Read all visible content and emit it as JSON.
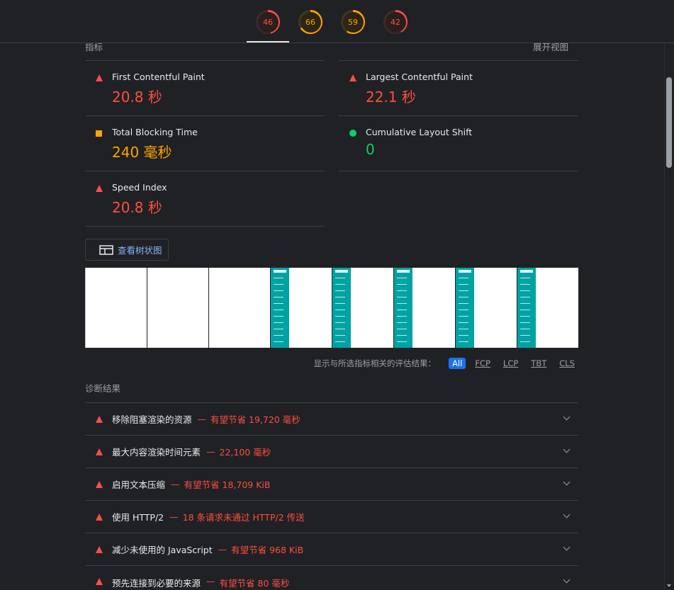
{
  "scores": [
    {
      "value": "46",
      "status": "fail",
      "percent": 46
    },
    {
      "value": "66",
      "status": "average",
      "percent": 66
    },
    {
      "value": "59",
      "status": "average",
      "percent": 59
    },
    {
      "value": "42",
      "status": "fail",
      "percent": 42
    }
  ],
  "header": {
    "metrics_label": "指标",
    "expand_view": "展开视图"
  },
  "metrics": [
    {
      "title": "First Contentful Paint",
      "value": "20.8 秒",
      "status": "fail"
    },
    {
      "title": "Largest Contentful Paint",
      "value": "22.1 秒",
      "status": "fail"
    },
    {
      "title": "Total Blocking Time",
      "value": "240 毫秒",
      "status": "average"
    },
    {
      "title": "Cumulative Layout Shift",
      "value": "0",
      "status": "pass"
    },
    {
      "title": "Speed Index",
      "value": "20.8 秒",
      "status": "fail"
    }
  ],
  "treemap_button": "查看树状图",
  "filter": {
    "label": "显示与所选指标相关的评估结果：",
    "options": [
      "All",
      "FCP",
      "LCP",
      "TBT",
      "CLS"
    ],
    "selected": "All"
  },
  "diagnostics": {
    "title": "诊断结果",
    "items": [
      {
        "title": "移除阻塞渲染的资源",
        "detail": "有望节省 19,720 毫秒"
      },
      {
        "title": "最大内容渲染时间元素",
        "detail": "22,100 毫秒"
      },
      {
        "title": "启用文本压缩",
        "detail": "有望节省 18,709 KiB"
      },
      {
        "title": "使用 HTTP/2",
        "detail": "18 条请求未通过 HTTP/2 传送"
      },
      {
        "title": "减少未使用的 JavaScript",
        "detail": "有望节省 968 KiB"
      },
      {
        "title": "预先连接到必要的来源",
        "detail": "有望节省 80 毫秒"
      }
    ]
  },
  "colors": {
    "fail": "#ff4e42",
    "average": "#ffa400",
    "pass": "#0cce6b",
    "accent": "#1a73e8",
    "link": "#8ab4f8",
    "background": "#202124"
  }
}
